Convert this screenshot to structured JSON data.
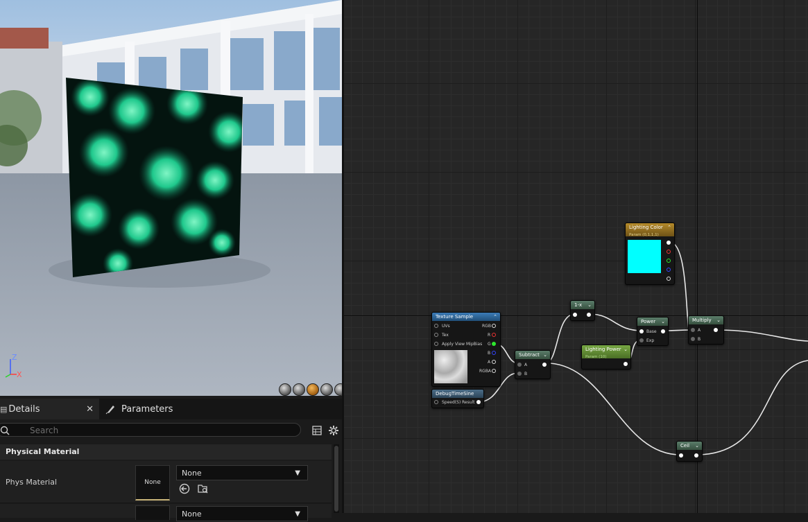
{
  "viewport": {
    "axis_z": "Z",
    "axis_x": "X",
    "preview_buttons": [
      "cylinder-icon",
      "sphere-icon",
      "plane-icon",
      "cube-icon",
      "teapot-icon"
    ]
  },
  "details_panel": {
    "tabs": [
      {
        "label": "Details",
        "icon": "details-icon",
        "closable": true
      },
      {
        "label": "Parameters",
        "icon": "parameters-icon",
        "closable": false
      }
    ],
    "search_placeholder": "Search",
    "section_title": "Physical Material",
    "rows": [
      {
        "label": "Phys Material",
        "thumbnail": "None",
        "value": "None"
      },
      {
        "label": "",
        "thumbnail": "",
        "value": "None"
      }
    ]
  },
  "graph": {
    "nodes": {
      "texture_sample": {
        "title": "Texture Sample",
        "inputs": [
          "UVs",
          "Tex",
          "Apply View MipBias"
        ],
        "outputs": [
          "RGB",
          "R",
          "G",
          "B",
          "A",
          "RGBA"
        ]
      },
      "debug_time_sine": {
        "title": "DebugTimeSine",
        "inputs": [
          "Speed(S)"
        ],
        "outputs": [
          "Result"
        ]
      },
      "subtract": {
        "title": "Subtract",
        "inputs": [
          "A",
          "B"
        ]
      },
      "one_minus": {
        "title": "1-x"
      },
      "power": {
        "title": "Power",
        "inputs": [
          "Base",
          "Exp"
        ]
      },
      "lighting_power": {
        "title": "Lighting Power",
        "subtitle": "Param (10)"
      },
      "lighting_color": {
        "title": "Lighting Color",
        "subtitle": "Param (0,1,1,1)",
        "swatch_color": "#00ffff"
      },
      "multiply": {
        "title": "Multiply",
        "inputs": [
          "A",
          "B"
        ]
      },
      "ceil": {
        "title": "Ceil"
      }
    }
  },
  "colors": {
    "accent_orange": "#e89a2c",
    "texture_header": "#2a5f8e",
    "math_header": "#3d5a4a",
    "param_vector_header": "#8a6a1e",
    "param_scalar_header": "#5b8a2e"
  }
}
